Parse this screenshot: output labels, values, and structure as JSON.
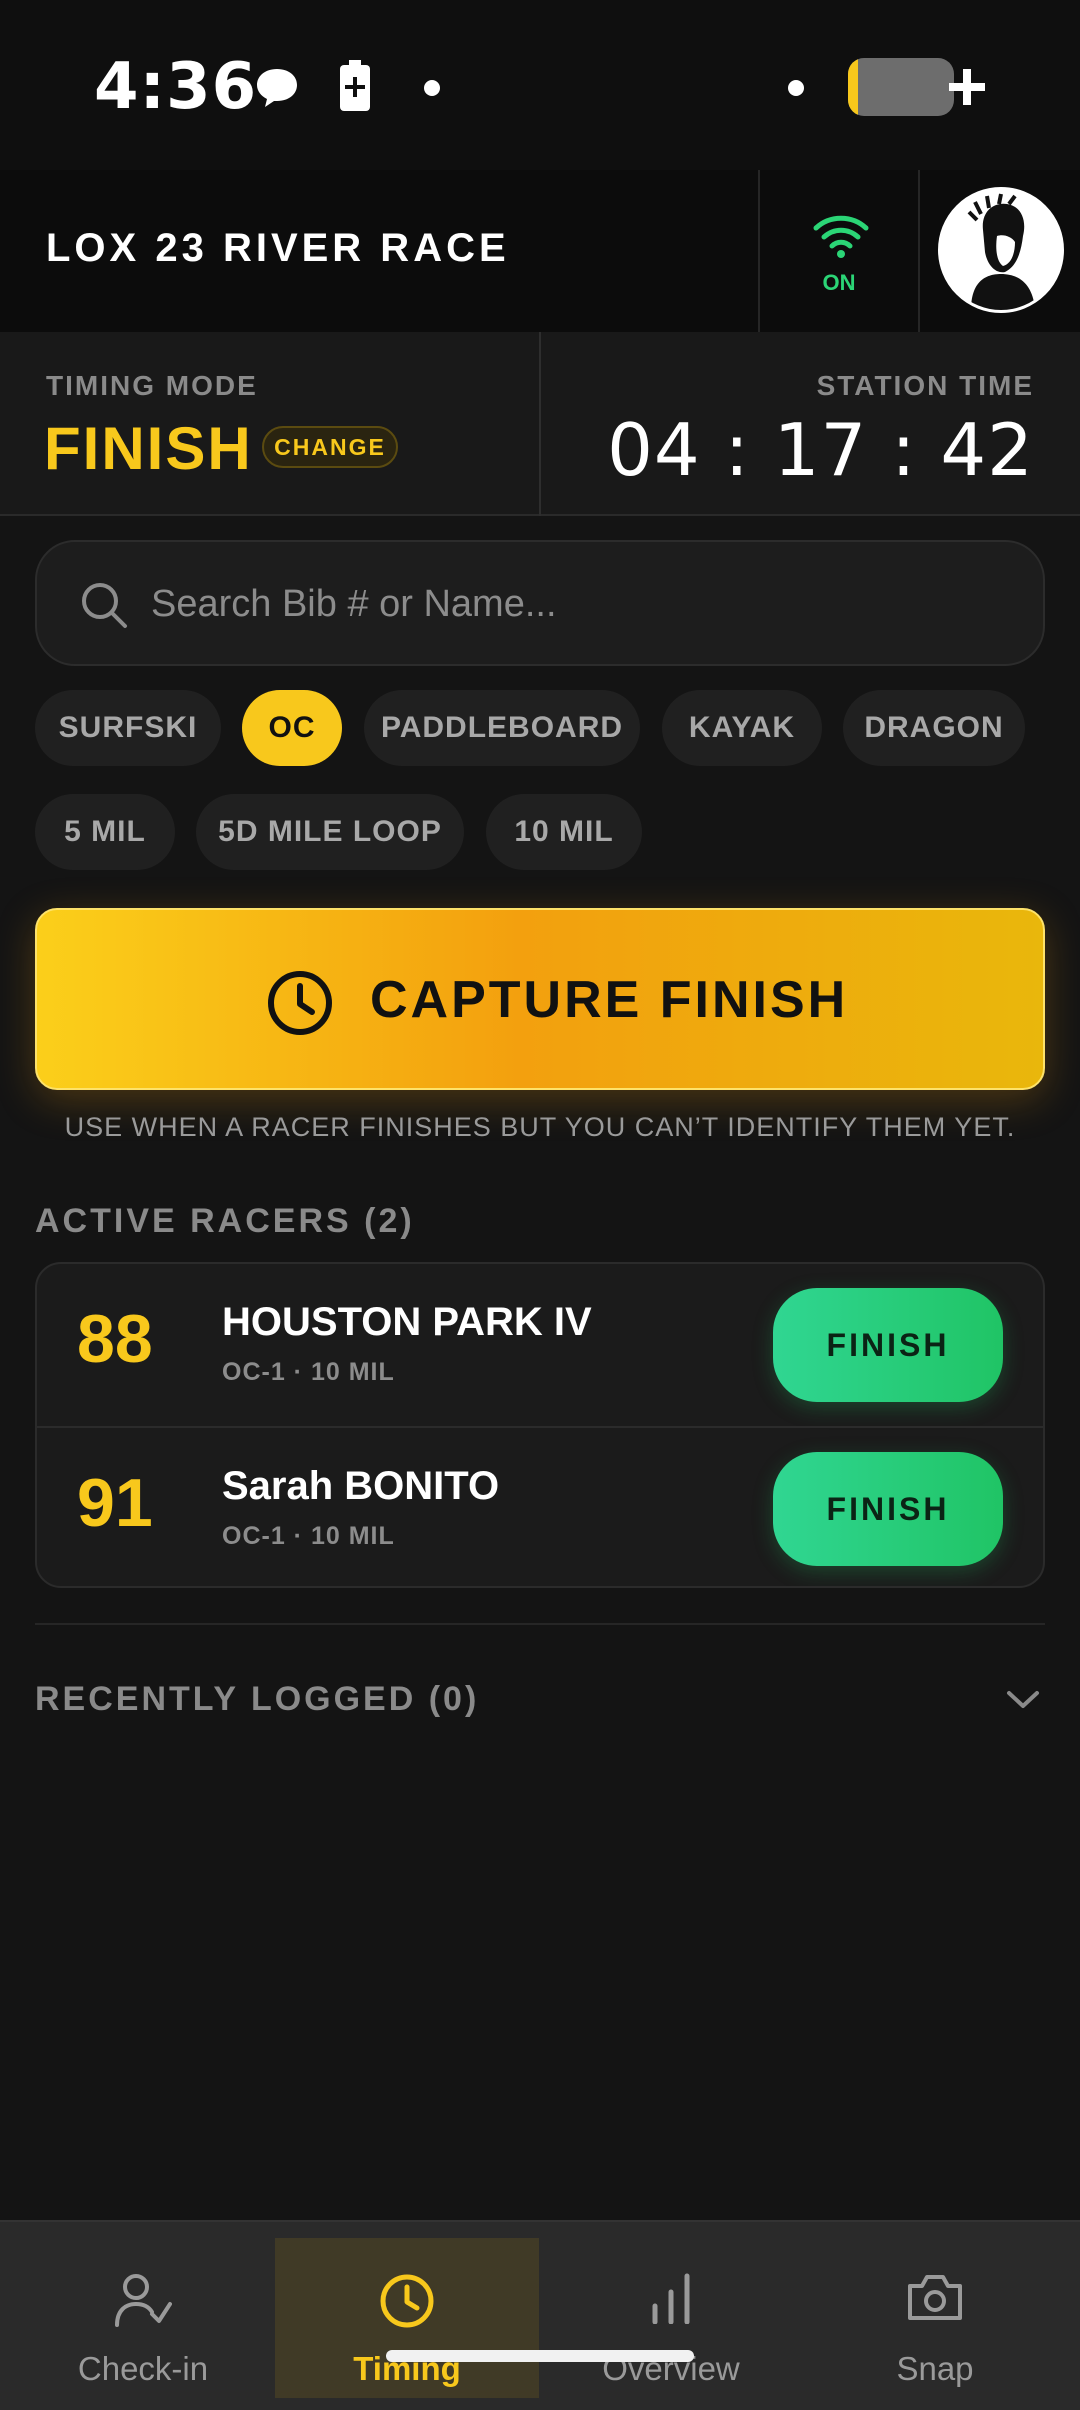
{
  "status_bar": {
    "time": "4:36",
    "icons": [
      "chat-bubble-icon",
      "battery-saver-icon",
      "dot-icon",
      "dot-icon",
      "battery-icon",
      "plus-icon"
    ]
  },
  "header": {
    "title": "LOX 23 RIVER RACE",
    "connection_label": "ON",
    "connection_icon": "wifi-icon",
    "avatar_icon": "user-avatar"
  },
  "timing": {
    "mode_label": "TIMING MODE",
    "mode_value": "FINISH",
    "change_label": "CHANGE",
    "station_label": "STATION TIME",
    "station_time": "04 : 17 : 42"
  },
  "search": {
    "placeholder": "Search Bib # or Name...",
    "value": ""
  },
  "filters": {
    "craft": [
      "SURFSKI",
      "OC",
      "PADDLEBOARD",
      "KAYAK",
      "DRAGON"
    ],
    "craft_selected": "OC",
    "distance": [
      "5 MIL",
      "5D MILE LOOP",
      "10 MIL"
    ]
  },
  "capture": {
    "label": "CAPTURE FINISH",
    "hint": "USE WHEN A RACER FINISHES BUT YOU CAN’T IDENTIFY THEM YET."
  },
  "active_racers": {
    "title": "ACTIVE RACERS (2)",
    "racers": [
      {
        "bib": "88",
        "name": "HOUSTON PARK IV",
        "meta": "OC-1 · 10 MIL",
        "action": "FINISH"
      },
      {
        "bib": "91",
        "name": "Sarah BONITO",
        "meta": "OC-1 · 10 MIL",
        "action": "FINISH"
      }
    ]
  },
  "recently_logged": {
    "title": "RECENTLY LOGGED (0)"
  },
  "nav": {
    "items": [
      {
        "label": "Check-in",
        "icon": "user-check-icon"
      },
      {
        "label": "Timing",
        "icon": "clock-icon"
      },
      {
        "label": "Overview",
        "icon": "bar-chart-icon"
      },
      {
        "label": "Snap",
        "icon": "camera-icon"
      }
    ],
    "active": "Timing"
  },
  "colors": {
    "accent": "#f8c81c",
    "success": "#20c465",
    "background": "#141414"
  }
}
